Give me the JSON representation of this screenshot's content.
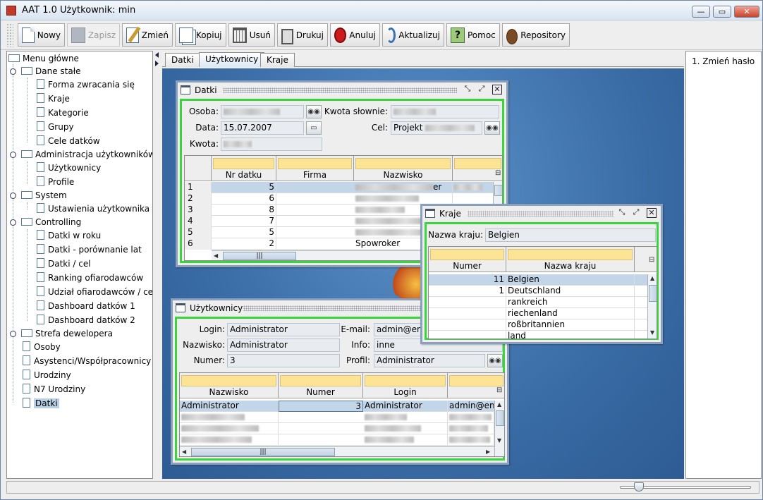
{
  "window": {
    "title": "AAT 1.0  Użytkownik: min",
    "min": "—",
    "max": "▭",
    "close": "✕"
  },
  "toolbar": {
    "new": "Nowy",
    "save": "Zapisz",
    "edit": "Zmień",
    "copy": "Kopiuj",
    "delete": "Usuń",
    "print": "Drukuj",
    "cancel": "Anuluj",
    "refresh": "Aktualizuj",
    "help": "Pomoc",
    "repository": "Repository"
  },
  "tree": {
    "root": "Menu główne",
    "items": [
      {
        "label": "Dane stałe"
      },
      {
        "label": "Forma zwracania się"
      },
      {
        "label": "Kraje"
      },
      {
        "label": "Kategorie"
      },
      {
        "label": "Grupy"
      },
      {
        "label": "Cele datków"
      },
      {
        "label": "Administracja użytkowników"
      },
      {
        "label": "Użytkownicy"
      },
      {
        "label": "Profile"
      },
      {
        "label": "System"
      },
      {
        "label": "Ustawienia użytkownika"
      },
      {
        "label": "Controlling"
      },
      {
        "label": "Datki w roku"
      },
      {
        "label": "Datki - porównanie lat"
      },
      {
        "label": "Datki / cel"
      },
      {
        "label": "Ranking ofiarodawców"
      },
      {
        "label": "Udział ofiarodawców / cel"
      },
      {
        "label": "Dashboard datków 1"
      },
      {
        "label": "Dashboard datków 2"
      },
      {
        "label": "Strefa dewelopera"
      },
      {
        "label": "Osoby"
      },
      {
        "label": "Asystenci/Współpracownicy"
      },
      {
        "label": "Urodziny"
      },
      {
        "label": "N7 Urodziny"
      },
      {
        "label": "Datki"
      }
    ]
  },
  "tabs": [
    "Datki",
    "Użytkownicy",
    "Kraje"
  ],
  "right_panel": {
    "action": "1. Zmień hasło"
  },
  "datki": {
    "title": "Datki",
    "osoba_label": "Osoba:",
    "data_label": "Data:",
    "data_value": "15.07.2007",
    "kwota_label": "Kwota:",
    "kwota_slownie_label": "Kwota słownie:",
    "cel_label": "Cel:",
    "cel_value": "Projekt",
    "columns": [
      "Nr datku",
      "Firma",
      "Nazwisko"
    ],
    "row_numbers": [
      "1",
      "2",
      "3",
      "4",
      "5",
      "6"
    ],
    "nr_values": [
      "5",
      "6",
      "8",
      "7",
      "5",
      "2"
    ],
    "nazwisko_fragments": {
      "row1": "er",
      "row6": "Spowroker"
    }
  },
  "kraje": {
    "title": "Kraje",
    "nazwa_label": "Nazwa kraju:",
    "nazwa_value": "Belgien",
    "columns": [
      "Numer",
      "Nazwa kraju"
    ],
    "rows": [
      {
        "numer": "11",
        "nazwa": "Belgien"
      },
      {
        "numer": "1",
        "nazwa": "Deutschland"
      },
      {
        "numer": "",
        "nazwa": "rankreich"
      },
      {
        "numer": "",
        "nazwa": "riechenland"
      },
      {
        "numer": "",
        "nazwa": "roßbritannien"
      },
      {
        "numer": "",
        "nazwa": "land"
      }
    ]
  },
  "uzytkownicy": {
    "title": "Użytkownicy",
    "login_label": "Login:",
    "login_value": "Administrator",
    "nazwisko_label": "Nazwisko:",
    "nazwisko_value": "Administrator",
    "numer_label": "Numer:",
    "numer_value": "3",
    "email_label": "E-mail:",
    "email_value": "admin@email.de",
    "info_label": "Info:",
    "info_value": "inne",
    "profil_label": "Profil:",
    "profil_value": "Administrator",
    "columns": [
      "Nazwisko",
      "Numer",
      "Login"
    ],
    "row1": {
      "nazwisko": "Administrator",
      "numer": "3",
      "login": "Administrator",
      "email": "admin@em"
    }
  },
  "colors": {
    "accent_border": "#3cd43c",
    "filter_cell": "#fde394",
    "selection": "#c3d5e8"
  }
}
